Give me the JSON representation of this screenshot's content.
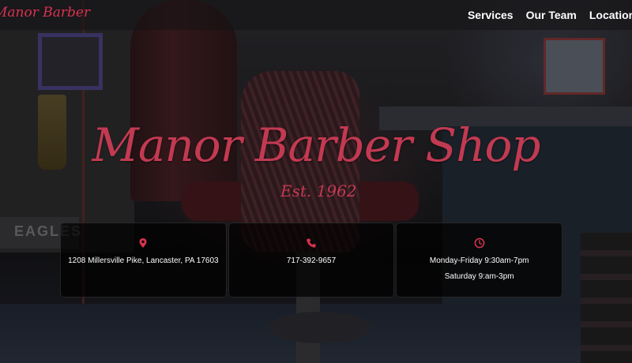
{
  "brand": {
    "logo_text": "Manor Barber",
    "accent_color": "#d9334f"
  },
  "nav": {
    "items": [
      {
        "label": "Services"
      },
      {
        "label": "Our Team"
      },
      {
        "label": "Locations"
      }
    ]
  },
  "hero": {
    "title": "Manor Barber Shop",
    "subtitle": "Est. 1962"
  },
  "cards": [
    {
      "icon": "map-pin-icon",
      "lines": [
        "1208 Millersville Pike, Lancaster, PA 17603"
      ]
    },
    {
      "icon": "phone-icon",
      "lines": [
        "717-392-9657"
      ]
    },
    {
      "icon": "clock-icon",
      "lines": [
        "Monday-Friday 9:30am-7pm",
        "Saturday 9:am-3pm"
      ]
    }
  ]
}
